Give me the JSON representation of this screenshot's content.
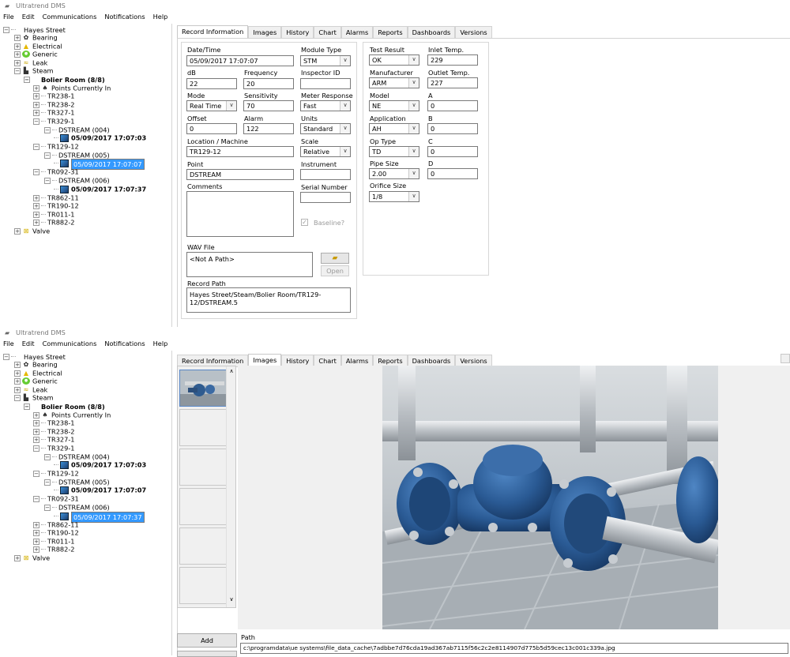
{
  "app": {
    "title": "Ultratrend DMS"
  },
  "menu": [
    "File",
    "Edit",
    "Communications",
    "Notifications",
    "Help"
  ],
  "tree": {
    "root": "Hayes Street",
    "categories": [
      "Bearing",
      "Electrical",
      "Generic",
      "Leak",
      "Steam",
      "Valve"
    ],
    "room": "Bolier Room (8/8)",
    "points_in": "Points Currently In",
    "points": [
      "TR238-1",
      "TR238-2",
      "TR327-1",
      "TR329-1",
      "TR129-12",
      "TR092-31",
      "TR862-11",
      "TR190-12",
      "TR011-1",
      "TR882-2"
    ],
    "streams": [
      "DSTREAM (004)",
      "DSTREAM (005)",
      "DSTREAM (006)"
    ],
    "records": [
      "05/09/2017 17:07:03",
      "05/09/2017 17:07:07",
      "05/09/2017 17:07:37"
    ]
  },
  "tabs": [
    "Record Information",
    "Images",
    "History",
    "Chart",
    "Alarms",
    "Reports",
    "Dashboards",
    "Versions"
  ],
  "record": {
    "datetime_label": "Date/Time",
    "datetime": "05/09/2017  17:07:07",
    "module_type_label": "Module Type",
    "module_type": "STM",
    "db_label": "dB",
    "db": "22",
    "frequency_label": "Frequency",
    "frequency": "20",
    "inspector_label": "Inspector ID",
    "inspector": "",
    "mode_label": "Mode",
    "mode": "Real Time",
    "sensitivity_label": "Sensitivity",
    "sensitivity": "70",
    "meter_label": "Meter Response",
    "meter": "Fast",
    "offset_label": "Offset",
    "offset": "0",
    "alarm_label": "Alarm",
    "alarm": "122",
    "units_label": "Units",
    "units": "Standard",
    "location_label": "Location / Machine",
    "location": "TR129-12",
    "scale_label": "Scale",
    "scale": "Relative",
    "point_label": "Point",
    "point": "DSTREAM",
    "instrument_label": "Instrument",
    "instrument": "",
    "comments_label": "Comments",
    "comments": "",
    "serial_label": "Serial Number",
    "serial": "",
    "baseline_label": "Baseline?",
    "wav_label": "WAV File",
    "wav": "<Not A Path>",
    "open_label": "Open",
    "path_label": "Record Path",
    "path": "Hayes Street/Steam/Bolier Room/TR129-12/DSTREAM.5",
    "test_result_label": "Test Result",
    "test_result": "OK",
    "inlet_label": "Inlet Temp.",
    "inlet": "229",
    "manufacturer_label": "Manufacturer",
    "manufacturer": "ARM",
    "outlet_label": "Outlet Temp.",
    "outlet": "227",
    "model_label": "Model",
    "model": "NE",
    "a_label": "A",
    "a": "0",
    "application_label": "Application",
    "application": "AH",
    "b_label": "B",
    "b": "0",
    "optype_label": "Op Type",
    "optype": "TD",
    "c_label": "C",
    "c": "0",
    "pipe_label": "Pipe Size",
    "pipe": "2.00",
    "d_label": "D",
    "d": "0",
    "orifice_label": "Orifice Size",
    "orifice": "1/8"
  },
  "images": {
    "add_label": "Add",
    "path_label": "Path",
    "path": "c:\\programdata\\ue systems\\file_data_cache\\7adbbe7d76cda19ad367ab7115f56c2c2e8114907d775b5d59cec13c001c339a.jpg"
  }
}
